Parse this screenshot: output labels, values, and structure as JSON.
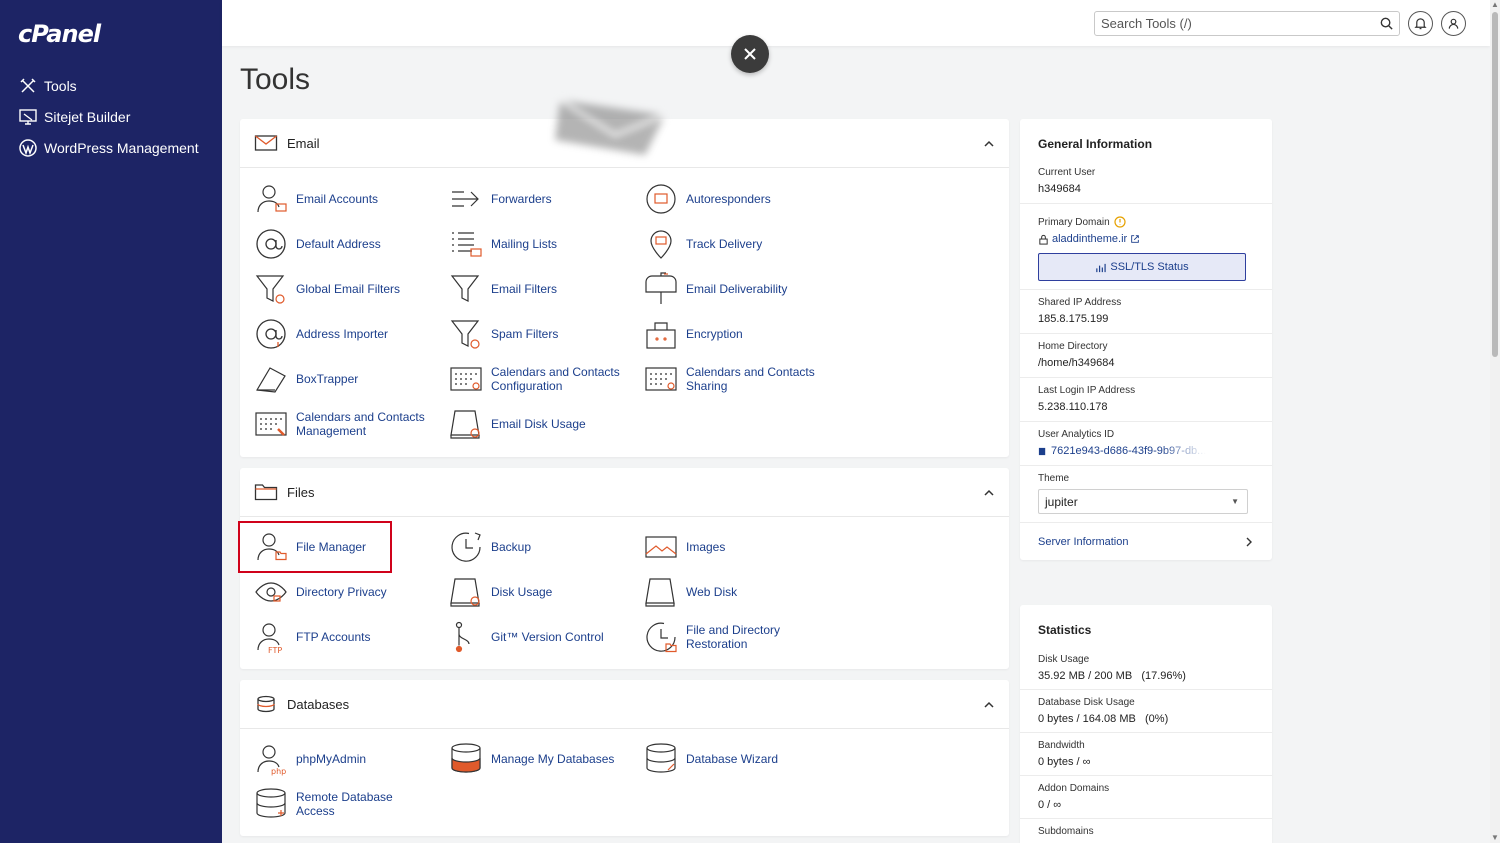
{
  "app": {
    "logo": "cPanel"
  },
  "sidebar": {
    "items": [
      {
        "label": "Tools",
        "icon": "tools-icon"
      },
      {
        "label": "Sitejet Builder",
        "icon": "sitejet-icon"
      },
      {
        "label": "WordPress Management",
        "icon": "wordpress-icon"
      }
    ]
  },
  "search": {
    "placeholder": "Search Tools (/)"
  },
  "page": {
    "title": "Tools"
  },
  "sections": {
    "email": {
      "title": "Email",
      "tools": [
        {
          "label": "Email Accounts",
          "icon": "email-accounts-icon"
        },
        {
          "label": "Forwarders",
          "icon": "forwarders-icon"
        },
        {
          "label": "Autoresponders",
          "icon": "autoresponders-icon"
        },
        {
          "label": "Default Address",
          "icon": "default-address-icon"
        },
        {
          "label": "Mailing Lists",
          "icon": "mailing-lists-icon"
        },
        {
          "label": "Track Delivery",
          "icon": "track-delivery-icon"
        },
        {
          "label": "Global Email Filters",
          "icon": "global-email-filters-icon"
        },
        {
          "label": "Email Filters",
          "icon": "email-filters-icon"
        },
        {
          "label": "Email Deliverability",
          "icon": "email-deliverability-icon"
        },
        {
          "label": "Address Importer",
          "icon": "address-importer-icon"
        },
        {
          "label": "Spam Filters",
          "icon": "spam-filters-icon"
        },
        {
          "label": "Encryption",
          "icon": "encryption-icon"
        },
        {
          "label": "BoxTrapper",
          "icon": "boxtrapper-icon"
        },
        {
          "label": "Calendars and Contacts Configuration",
          "icon": "calendar-config-icon"
        },
        {
          "label": "Calendars and Contacts Sharing",
          "icon": "calendar-sharing-icon"
        },
        {
          "label": "Calendars and Contacts Management",
          "icon": "calendar-management-icon"
        },
        {
          "label": "Email Disk Usage",
          "icon": "email-disk-usage-icon"
        }
      ]
    },
    "files": {
      "title": "Files",
      "tools": [
        {
          "label": "File Manager",
          "icon": "file-manager-icon"
        },
        {
          "label": "Backup",
          "icon": "backup-icon"
        },
        {
          "label": "Images",
          "icon": "images-icon"
        },
        {
          "label": "Directory Privacy",
          "icon": "directory-privacy-icon"
        },
        {
          "label": "Disk Usage",
          "icon": "disk-usage-icon"
        },
        {
          "label": "Web Disk",
          "icon": "web-disk-icon"
        },
        {
          "label": "FTP Accounts",
          "icon": "ftp-accounts-icon"
        },
        {
          "label": "Git™ Version Control",
          "icon": "git-icon"
        },
        {
          "label": "File and Directory Restoration",
          "icon": "file-restoration-icon"
        }
      ]
    },
    "databases": {
      "title": "Databases",
      "tools": [
        {
          "label": "phpMyAdmin",
          "icon": "phpmyadmin-icon"
        },
        {
          "label": "Manage My Databases",
          "icon": "manage-databases-icon"
        },
        {
          "label": "Database Wizard",
          "icon": "database-wizard-icon"
        },
        {
          "label": "Remote Database Access",
          "icon": "remote-database-icon"
        }
      ]
    }
  },
  "general_info": {
    "title": "General Information",
    "current_user_label": "Current User",
    "current_user": "h349684",
    "primary_domain_label": "Primary Domain",
    "primary_domain": "aladdintheme.ir",
    "ssl_button": "SSL/TLS Status",
    "shared_ip_label": "Shared IP Address",
    "shared_ip": "185.8.175.199",
    "home_dir_label": "Home Directory",
    "home_dir": "/home/h349684",
    "last_login_label": "Last Login IP Address",
    "last_login": "5.238.110.178",
    "analytics_label": "User Analytics ID",
    "analytics_id": "7621e943-d686-43f9-9b97-db...",
    "theme_label": "Theme",
    "theme": "jupiter",
    "server_info": "Server Information"
  },
  "statistics": {
    "title": "Statistics",
    "items": [
      {
        "label": "Disk Usage",
        "value": "35.92 MB / 200 MB   (17.96%)"
      },
      {
        "label": "Database Disk Usage",
        "value": "0 bytes / 164.08 MB   (0%)"
      },
      {
        "label": "Bandwidth",
        "value": "0 bytes / ∞"
      },
      {
        "label": "Addon Domains",
        "value": "0 / ∞"
      },
      {
        "label": "Subdomains",
        "value": ""
      }
    ]
  },
  "colors": {
    "sidebar": "#1d2465",
    "link": "#1c3f8c",
    "accent": "#e05a2b",
    "highlight": "#d0021b"
  }
}
